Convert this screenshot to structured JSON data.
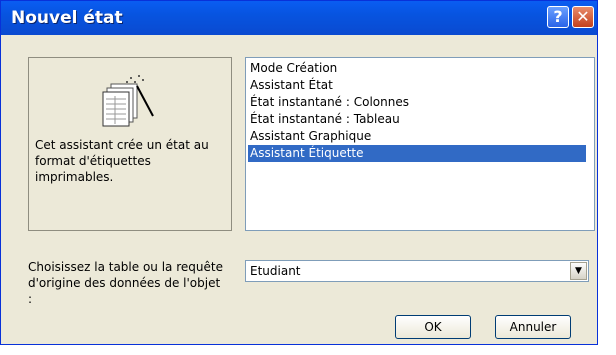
{
  "window": {
    "title": "Nouvel état",
    "help_label": "?",
    "close_label": "✕"
  },
  "description": "Cet assistant crée un état au format d'étiquettes imprimables.",
  "list": {
    "items": [
      "Mode Création",
      "Assistant État",
      "État instantané : Colonnes",
      "État instantané : Tableau",
      "Assistant Graphique",
      "Assistant Étiquette"
    ],
    "selected_index": 5
  },
  "source": {
    "label": "Choisissez la table ou la requête d'origine des données de l'objet :",
    "value": "Etudiant",
    "dropdown_glyph": "▼"
  },
  "buttons": {
    "ok": "OK",
    "cancel": "Annuler"
  },
  "colors": {
    "titlebar": "#0a5df2",
    "selection": "#316ac5",
    "dialog_bg": "#ece9d8"
  },
  "icons": {
    "wizard_illustration": "report-wizard-icon"
  }
}
